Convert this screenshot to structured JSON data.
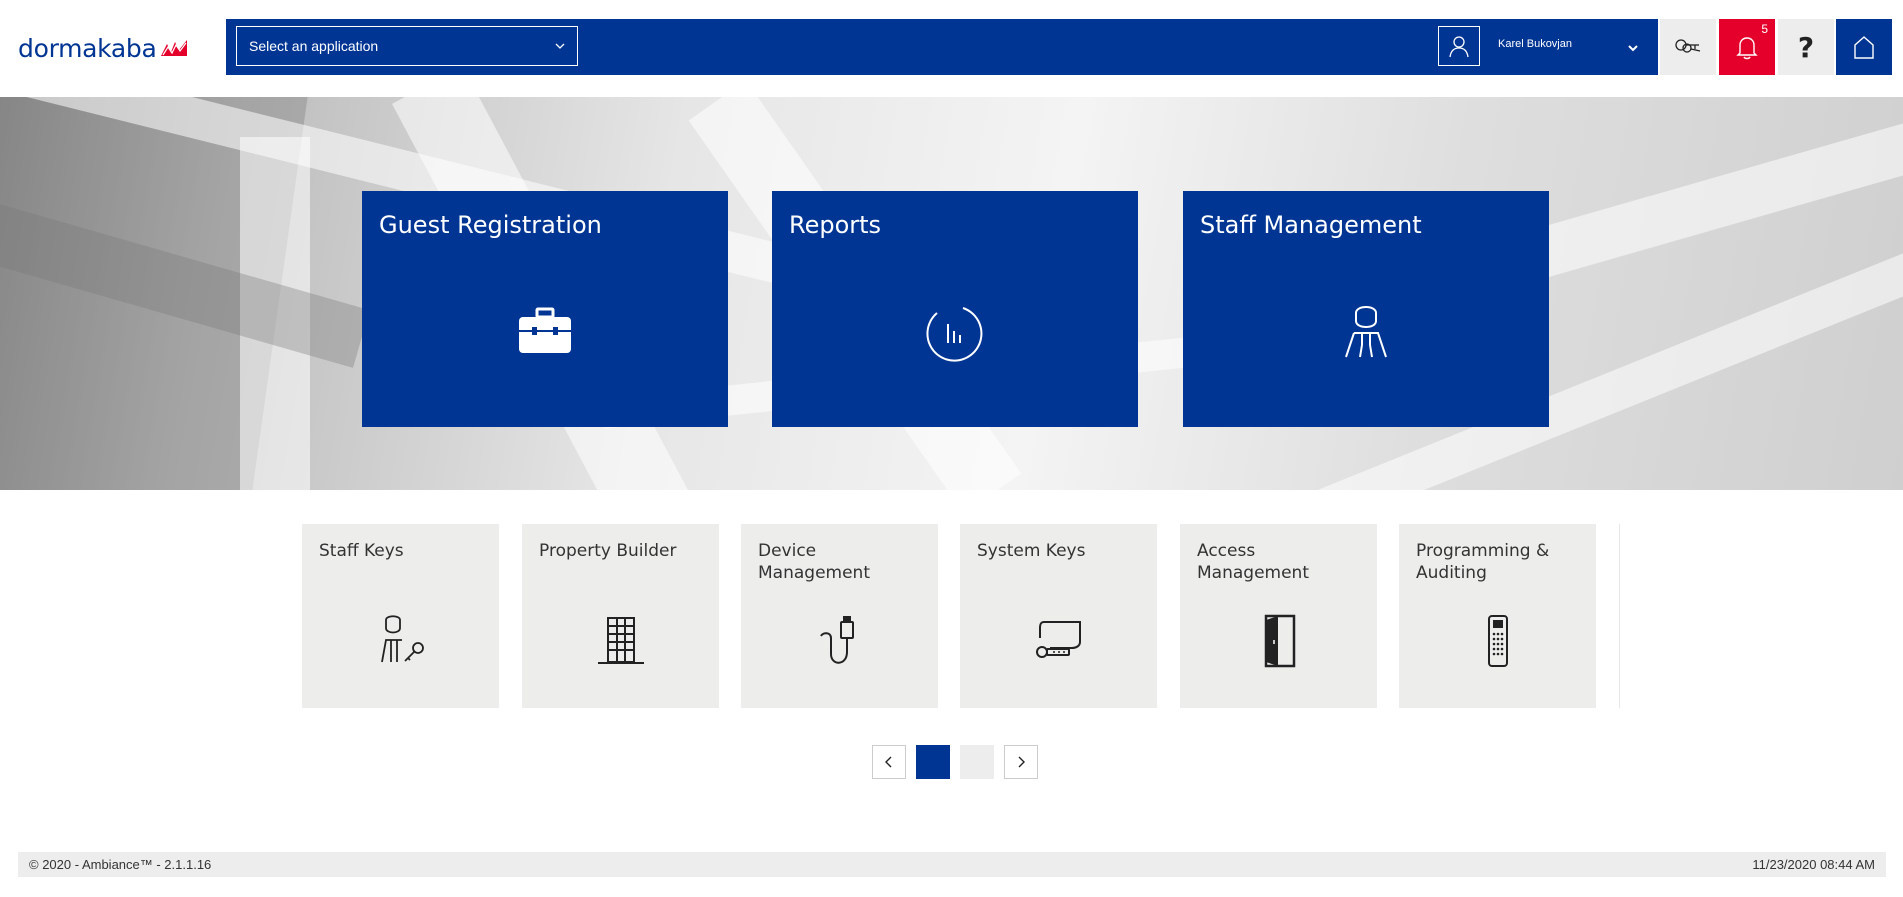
{
  "brand": {
    "name": "dormakaba",
    "accent": "#003594",
    "alert": "#e4002b"
  },
  "header": {
    "app_select": {
      "label": "Select an application"
    },
    "user": {
      "name": "Karel Bukovjan"
    },
    "notifications": {
      "count": "5"
    },
    "help": {
      "label": "?"
    },
    "icons": {
      "keys": "keys-icon",
      "bell": "bell-icon",
      "home": "home-icon",
      "user": "user-icon"
    }
  },
  "featured_tiles": [
    {
      "title": "Guest Registration",
      "icon": "briefcase-icon"
    },
    {
      "title": "Reports",
      "icon": "chart-icon"
    },
    {
      "title": "Staff Management",
      "icon": "staff-icon"
    }
  ],
  "tiles": [
    {
      "title": "Staff Keys",
      "icon": "staff-key-icon"
    },
    {
      "title": "Property Builder",
      "icon": "building-icon"
    },
    {
      "title": "Device Management",
      "icon": "device-icon"
    },
    {
      "title": "System Keys",
      "icon": "system-key-icon"
    },
    {
      "title": "Access Management",
      "icon": "door-icon"
    },
    {
      "title": "Programming & Auditing",
      "icon": "programmer-icon"
    }
  ],
  "pager": {
    "current_page": 1,
    "total_pages": 2
  },
  "footer": {
    "copyright": "© 2020 - Ambiance™ - 2.1.1.16",
    "datetime": "11/23/2020 08:44 AM"
  }
}
